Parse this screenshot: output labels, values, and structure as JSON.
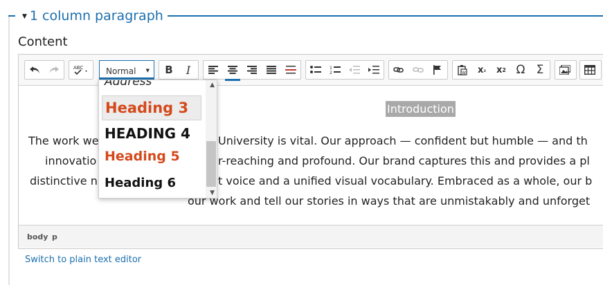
{
  "fieldset": {
    "legend": "1 column paragraph"
  },
  "field": {
    "label": "Content"
  },
  "toolbar": {
    "format_select": "Normal",
    "buttons": [
      {
        "name": "undo-icon"
      },
      {
        "name": "redo-icon"
      },
      {
        "name": "spellcheck-icon"
      },
      {
        "name": "bold-icon",
        "label": "B"
      },
      {
        "name": "italic-icon",
        "label": "I"
      },
      {
        "name": "align-left-icon"
      },
      {
        "name": "align-center-icon"
      },
      {
        "name": "align-right-icon"
      },
      {
        "name": "justify-icon"
      },
      {
        "name": "horizontal-rule-icon"
      },
      {
        "name": "bulleted-list-icon"
      },
      {
        "name": "numbered-list-icon"
      },
      {
        "name": "outdent-icon"
      },
      {
        "name": "indent-icon"
      },
      {
        "name": "link-icon"
      },
      {
        "name": "unlink-icon"
      },
      {
        "name": "anchor-flag-icon"
      },
      {
        "name": "paste-word-icon"
      },
      {
        "name": "subscript-icon"
      },
      {
        "name": "superscript-icon"
      },
      {
        "name": "special-char-icon",
        "label": "Ω"
      },
      {
        "name": "sigma-icon",
        "label": "Σ"
      },
      {
        "name": "image-icon"
      },
      {
        "name": "table-icon"
      }
    ]
  },
  "content": {
    "heading": "Introduction",
    "lines": [
      "The work we",
      "University is vital. Our approach — confident but humble — and th",
      "innovatio",
      "r-reaching and profound. Our brand captures this and provides a pl",
      "distinctive n",
      "t voice and a unified visual vocabulary. Embraced as a whole, our b",
      "our work and tell our stories in ways that are unmistakably and unforget"
    ]
  },
  "statusbar": {
    "path": [
      "body",
      "p"
    ]
  },
  "footer": {
    "switch_link": "Switch to plain text editor"
  },
  "format_dropdown": {
    "items": [
      {
        "label": "Address",
        "color": "#222222"
      },
      {
        "label": "Heading 3",
        "color": "#d4491b"
      },
      {
        "label": "HEADING 4",
        "color": "#111111"
      },
      {
        "label": "Heading 5",
        "color": "#d4491b"
      },
      {
        "label": "Heading 6",
        "color": "#111111"
      }
    ],
    "hovered": "Heading 3"
  },
  "colors": {
    "accent": "#1b6fae",
    "heading_orange": "#d4491b",
    "selection_gray": "#a9a9a9"
  }
}
